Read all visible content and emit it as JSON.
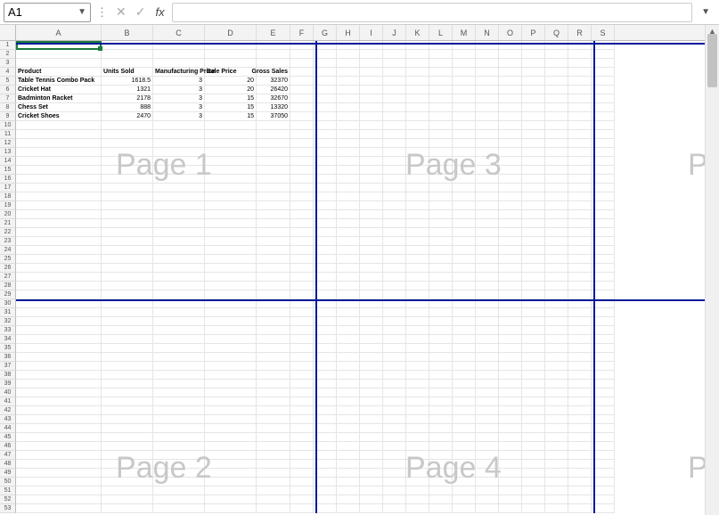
{
  "formula_bar": {
    "cell_ref": "A1",
    "formula": ""
  },
  "columns": [
    "A",
    "B",
    "C",
    "D",
    "E",
    "F",
    "G",
    "H",
    "I",
    "J",
    "K",
    "L",
    "M",
    "N",
    "O",
    "P",
    "Q",
    "R",
    "S"
  ],
  "headers": {
    "product": "Product",
    "units_sold": "Units Sold",
    "mfg_price": "Manufacturing Price",
    "sale_price": "Sale Price",
    "gross_sales": "Gross Sales"
  },
  "rows": [
    {
      "product": "Table Tennis Combo Pack",
      "units_sold": "1618.5",
      "mfg_price": "3",
      "sale_price": "20",
      "gross_sales": "32370"
    },
    {
      "product": "Cricket Hat",
      "units_sold": "1321",
      "mfg_price": "3",
      "sale_price": "20",
      "gross_sales": "26420"
    },
    {
      "product": "Badminton Racket",
      "units_sold": "2178",
      "mfg_price": "3",
      "sale_price": "15",
      "gross_sales": "32670"
    },
    {
      "product": "Chess Set",
      "units_sold": "888",
      "mfg_price": "3",
      "sale_price": "15",
      "gross_sales": "13320"
    },
    {
      "product": "Cricket Shoes",
      "units_sold": "2470",
      "mfg_price": "3",
      "sale_price": "15",
      "gross_sales": "37050"
    }
  ],
  "watermarks": {
    "p1": "Page 1",
    "p2": "Page 2",
    "p3": "Page 3",
    "p4": "Page 4",
    "p5": "P",
    "p6": "P"
  },
  "chart_data": {
    "type": "table",
    "columns": [
      "Product",
      "Units Sold",
      "Manufacturing Price",
      "Sale Price",
      "Gross Sales"
    ],
    "data": [
      [
        "Table Tennis Combo Pack",
        1618.5,
        3,
        20,
        32370
      ],
      [
        "Cricket Hat",
        1321,
        3,
        20,
        26420
      ],
      [
        "Badminton Racket",
        2178,
        3,
        15,
        32670
      ],
      [
        "Chess Set",
        888,
        3,
        15,
        13320
      ],
      [
        "Cricket Shoes",
        2470,
        3,
        15,
        37050
      ]
    ]
  }
}
